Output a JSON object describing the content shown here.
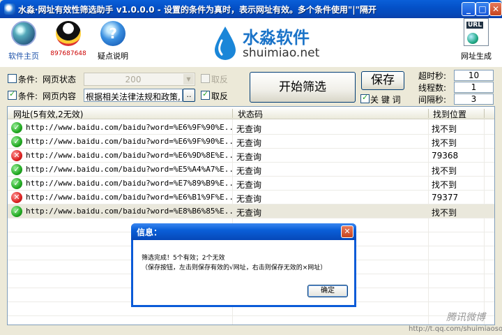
{
  "window": {
    "title": "水淼·网址有效性筛选助手 v1.0.0.0 - 设置的条件为真时，表示网址有效。多个条件使用\"|\"隔开",
    "minimize_icon": "minimize-icon",
    "maximize_icon": "maximize-icon",
    "close_icon": "close-icon"
  },
  "toolbar": {
    "home_label": "软件主页",
    "qq_label": "897687648",
    "help_label": "疑点说明",
    "help_glyph": "?",
    "urlgen_label": "网址生成",
    "urlgen_tag": "URL"
  },
  "logo": {
    "name_cn": "水淼软件",
    "name_en": "shuimiao.net"
  },
  "filters": {
    "cond1_label": "条件:",
    "cond1_field": "网页状态",
    "cond1_checked": false,
    "cond1_value": "200",
    "cond1_invert": "取反",
    "cond2_label": "条件:",
    "cond2_field": "网页内容",
    "cond2_checked": true,
    "cond2_value": "根据相关法律法规和政策,",
    "browse_label": "..",
    "cond2_invert": "取反",
    "start_label": "开始筛选",
    "save_label": "保存",
    "keyword_label": "关 键 词",
    "timeout_label": "超时秒:",
    "timeout_value": "10",
    "threads_label": "线程数:",
    "threads_value": "1",
    "interval_label": "间隔秒:",
    "interval_value": "3"
  },
  "table": {
    "col_url": "网址(5有效,2无效)",
    "col_status": "状态码",
    "col_found": "找到位置",
    "rows": [
      {
        "valid": true,
        "url": "http://www.baidu.com/baidu?word=%E6%9F%90%E...",
        "status": "无查询",
        "found": "找不到"
      },
      {
        "valid": true,
        "url": "http://www.baidu.com/baidu?word=%E6%9F%90%E...",
        "status": "无查询",
        "found": "找不到"
      },
      {
        "valid": false,
        "url": "http://www.baidu.com/baidu?word=%E6%9D%8E%E...",
        "status": "无查询",
        "found": "79368"
      },
      {
        "valid": true,
        "url": "http://www.baidu.com/baidu?word=%E5%A4%A7%E...",
        "status": "无查询",
        "found": "找不到"
      },
      {
        "valid": true,
        "url": "http://www.baidu.com/baidu?word=%E7%89%B9%E...",
        "status": "无查询",
        "found": "找不到"
      },
      {
        "valid": false,
        "url": "http://www.baidu.com/baidu?word=%E6%B1%9F%E...",
        "status": "无查询",
        "found": "79377"
      },
      {
        "valid": true,
        "url": "http://www.baidu.com/baidu?word=%E8%B6%85%E...",
        "status": "无查询",
        "found": "找不到"
      }
    ]
  },
  "dialog": {
    "title": "信息：",
    "line1": "筛选完成！5个有效；2个无效",
    "line2": "（保存按钮，左击则保存有效的√网址，右击则保存无效的×网址）",
    "ok_label": "确定"
  },
  "watermark": {
    "brand": "腾讯微博",
    "url": "http://t.qq.com/shuimiaosoft"
  }
}
